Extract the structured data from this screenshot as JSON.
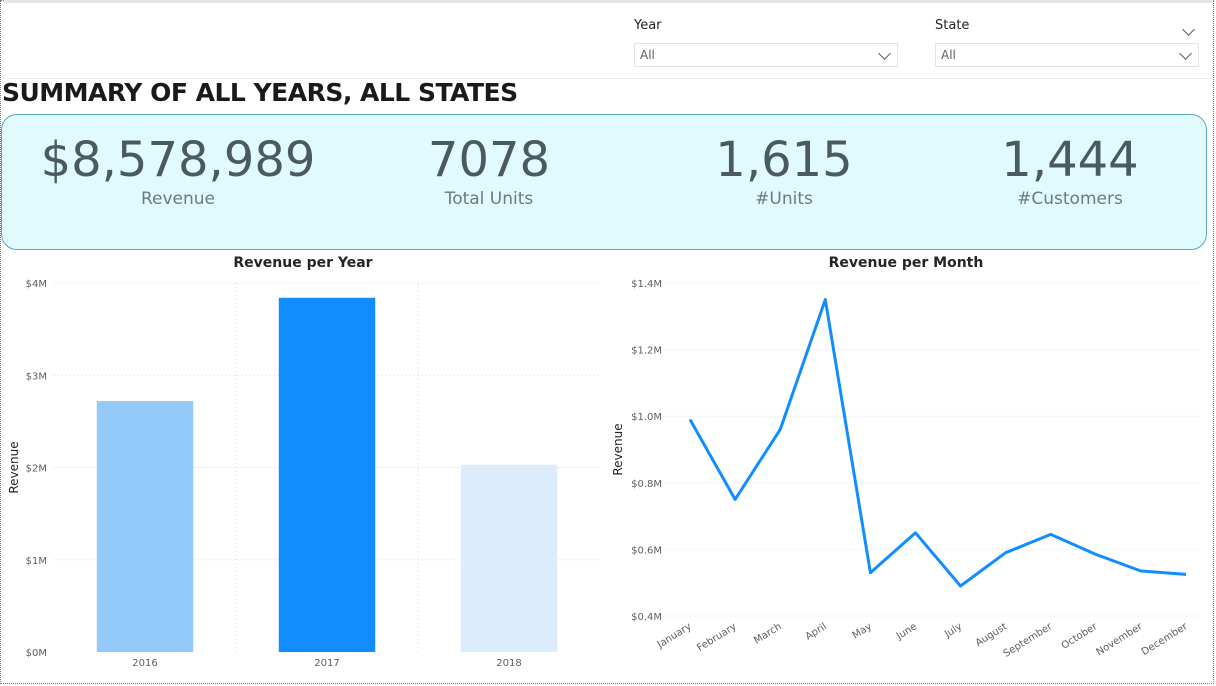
{
  "filters": {
    "year": {
      "label": "Year",
      "value": "All"
    },
    "state": {
      "label": "State",
      "value": "All"
    }
  },
  "page_title": "SUMMARY OF ALL YEARS, ALL STATES",
  "kpis": [
    {
      "value": "$8,578,989",
      "caption": "Revenue"
    },
    {
      "value": "7078",
      "caption": "Total Units"
    },
    {
      "value": "1,615",
      "caption": "#Units"
    },
    {
      "value": "1,444",
      "caption": "#Customers"
    }
  ],
  "chart_data": [
    {
      "type": "bar",
      "title": "Revenue per Year",
      "xlabel": "",
      "ylabel": "Revenue",
      "categories": [
        "2016",
        "2017",
        "2018"
      ],
      "values": [
        2.72,
        3.84,
        2.03
      ],
      "value_unit": "M",
      "ylim": [
        0,
        4
      ],
      "yticks": [
        "$0M",
        "$1M",
        "$2M",
        "$3M",
        "$4M"
      ],
      "bar_colors": [
        "#94caf9",
        "#118dff",
        "#dcecfd"
      ],
      "grid": true
    },
    {
      "type": "line",
      "title": "Revenue per Month",
      "xlabel": "",
      "ylabel": "Revenue",
      "categories": [
        "January",
        "February",
        "March",
        "April",
        "May",
        "June",
        "July",
        "August",
        "September",
        "October",
        "November",
        "December"
      ],
      "series": [
        {
          "values": [
            0.99,
            0.75,
            0.96,
            1.35,
            0.53,
            0.65,
            0.49,
            0.59,
            0.645,
            0.585,
            0.535,
            0.525
          ],
          "color": "#118dff"
        }
      ],
      "value_unit": "M",
      "ylim": [
        0.4,
        1.4
      ],
      "yticks": [
        "$0.4M",
        "$0.6M",
        "$0.8M",
        "$1.0M",
        "$1.2M",
        "$1.4M"
      ],
      "grid": true
    }
  ]
}
